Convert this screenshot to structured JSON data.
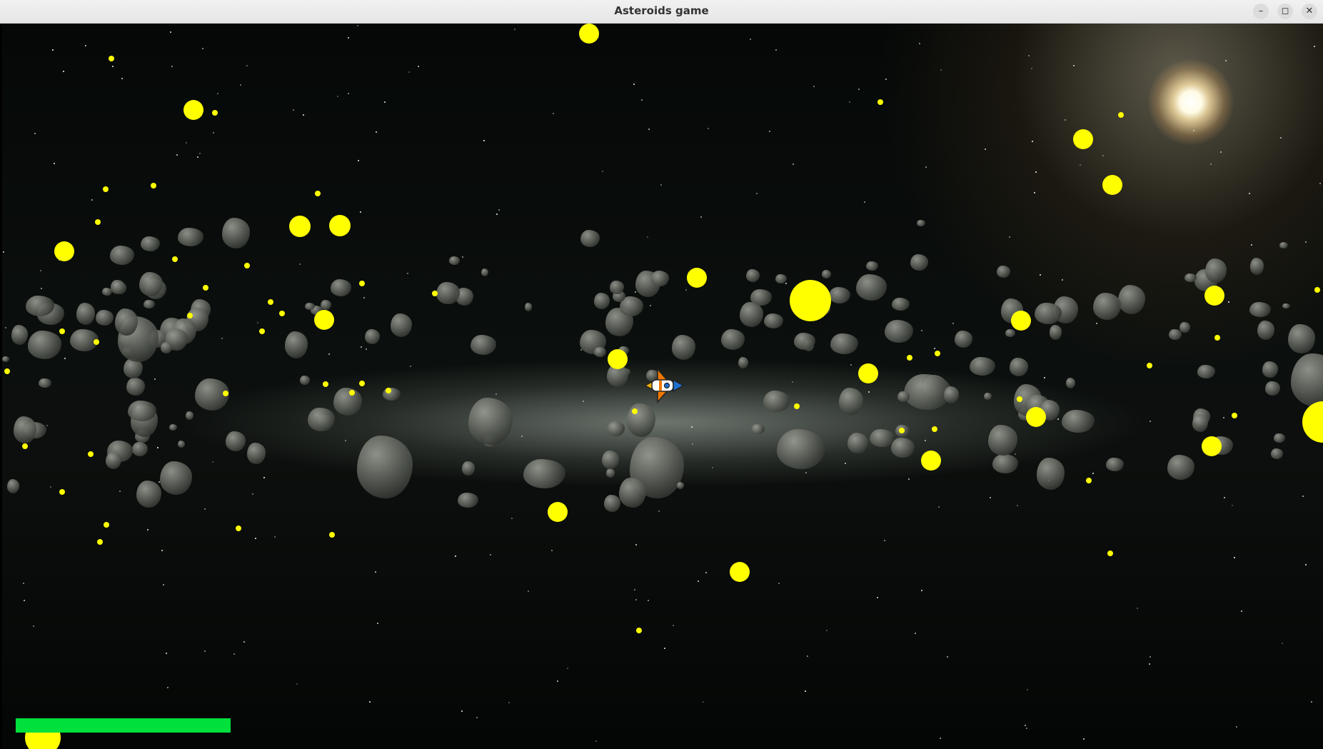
{
  "window": {
    "title": "Asteroids game",
    "controls": {
      "minimize": "–",
      "maximize": "◻",
      "close": "✕"
    }
  },
  "game": {
    "health_fraction": 1.0,
    "colors": {
      "collectible": "#ffff00",
      "health_bar": "#00e03c",
      "ship_body": "#f07800",
      "ship_cockpit": "#1e6fd0"
    },
    "icons": {
      "player": "spaceship-icon",
      "collectible": "yellow-orb",
      "sun": "sun-glow"
    }
  }
}
